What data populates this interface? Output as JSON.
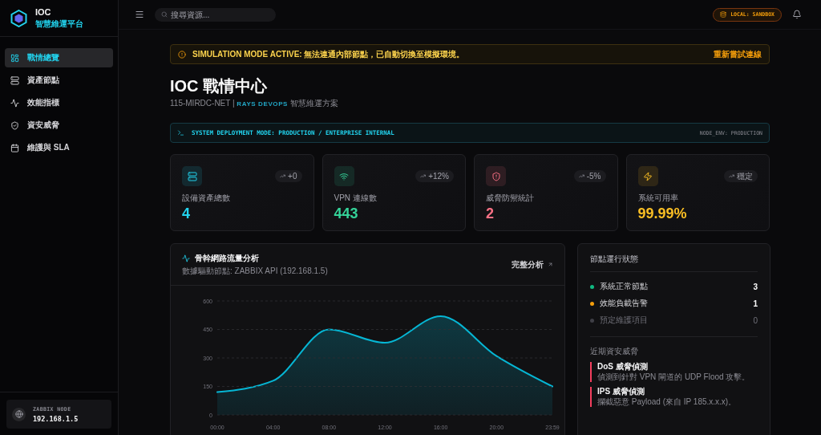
{
  "sidebar": {
    "brand": {
      "name": "IOC",
      "subtitle": "智慧維運平台"
    },
    "items": [
      {
        "label": "戰情總覽",
        "selected": true
      },
      {
        "label": "資產節點",
        "selected": false
      },
      {
        "label": "效能指標",
        "selected": false
      },
      {
        "label": "資安威脅",
        "selected": false
      },
      {
        "label": "維護與 SLA",
        "selected": false
      }
    ],
    "node": {
      "label": "ZABBIX NODE",
      "address": "192.168.1.5"
    }
  },
  "topbar": {
    "search": {
      "placeholder": "搜尋資源..."
    },
    "environment": "LOCAL: SANDBOX"
  },
  "banner": {
    "message": "SIMULATION MODE ACTIVE: 無法連通內部節點，已自動切換至模擬環境。",
    "action": "重新嘗試連線"
  },
  "header": {
    "title": "IOC 戰情中心",
    "subtitle": "115-MIRDC-NET | **RAYS DEVOPS** 智慧維運方案"
  },
  "deployment_bar": {
    "mode": "SYSTEM DEPLOYMENT MODE: PRODUCTION / ENTERPRISE INTERNAL",
    "environment": "NODE_ENV: PRODUCTION"
  },
  "stat_cards": [
    {
      "label": "設備資產總數",
      "value": "4",
      "trend": "+0",
      "color": "#22d3ee"
    },
    {
      "label": "VPN 連線數",
      "value": "443",
      "trend": "+12%",
      "color": "#34d399"
    },
    {
      "label": "威脅防禦統計",
      "value": "2",
      "trend": "-5%",
      "color": "#fb7185"
    },
    {
      "label": "系統可用率",
      "value": "99.99%",
      "trend": "穩定",
      "color": "#fbbf24"
    }
  ],
  "traffic_panel": {
    "title": "骨幹網路流量分析",
    "subtitle": "數據驅動節點: ZABBIX API (192.168.1.5)",
    "link": "完整分析",
    "chart_data": {
      "type": "area",
      "categories": [
        "00:00",
        "04:00",
        "08:00",
        "12:00",
        "16:00",
        "20:00",
        "23:59"
      ],
      "series": [
        {
          "color": "#06b6d4",
          "values": [
            120,
            180,
            450,
            380,
            520,
            310,
            150
          ]
        }
      ],
      "ylim": [
        0,
        600
      ],
      "yticks": [
        0,
        150,
        300,
        450,
        600
      ],
      "grid": true
    }
  },
  "status_panel": {
    "title": "節點運行狀態",
    "rows": [
      {
        "label": "系統正常節點",
        "value": "3",
        "color": "#10b981",
        "muted": false
      },
      {
        "label": "效能負載告警",
        "value": "1",
        "color": "#f59e0b",
        "muted": false
      },
      {
        "label": "預定維護項目",
        "value": "0",
        "color": "#3f3f46",
        "muted": true
      }
    ],
    "threats_title": "近期資安威脅",
    "threats": [
      {
        "title": "DoS 威脅偵測",
        "description": "偵測到針對 VPN 閘道的 UDP Flood 攻擊。"
      },
      {
        "title": "IPS 威脅偵測",
        "description": "攔截惡意 Payload (來自 IP 185.x.x.x)。"
      }
    ]
  }
}
